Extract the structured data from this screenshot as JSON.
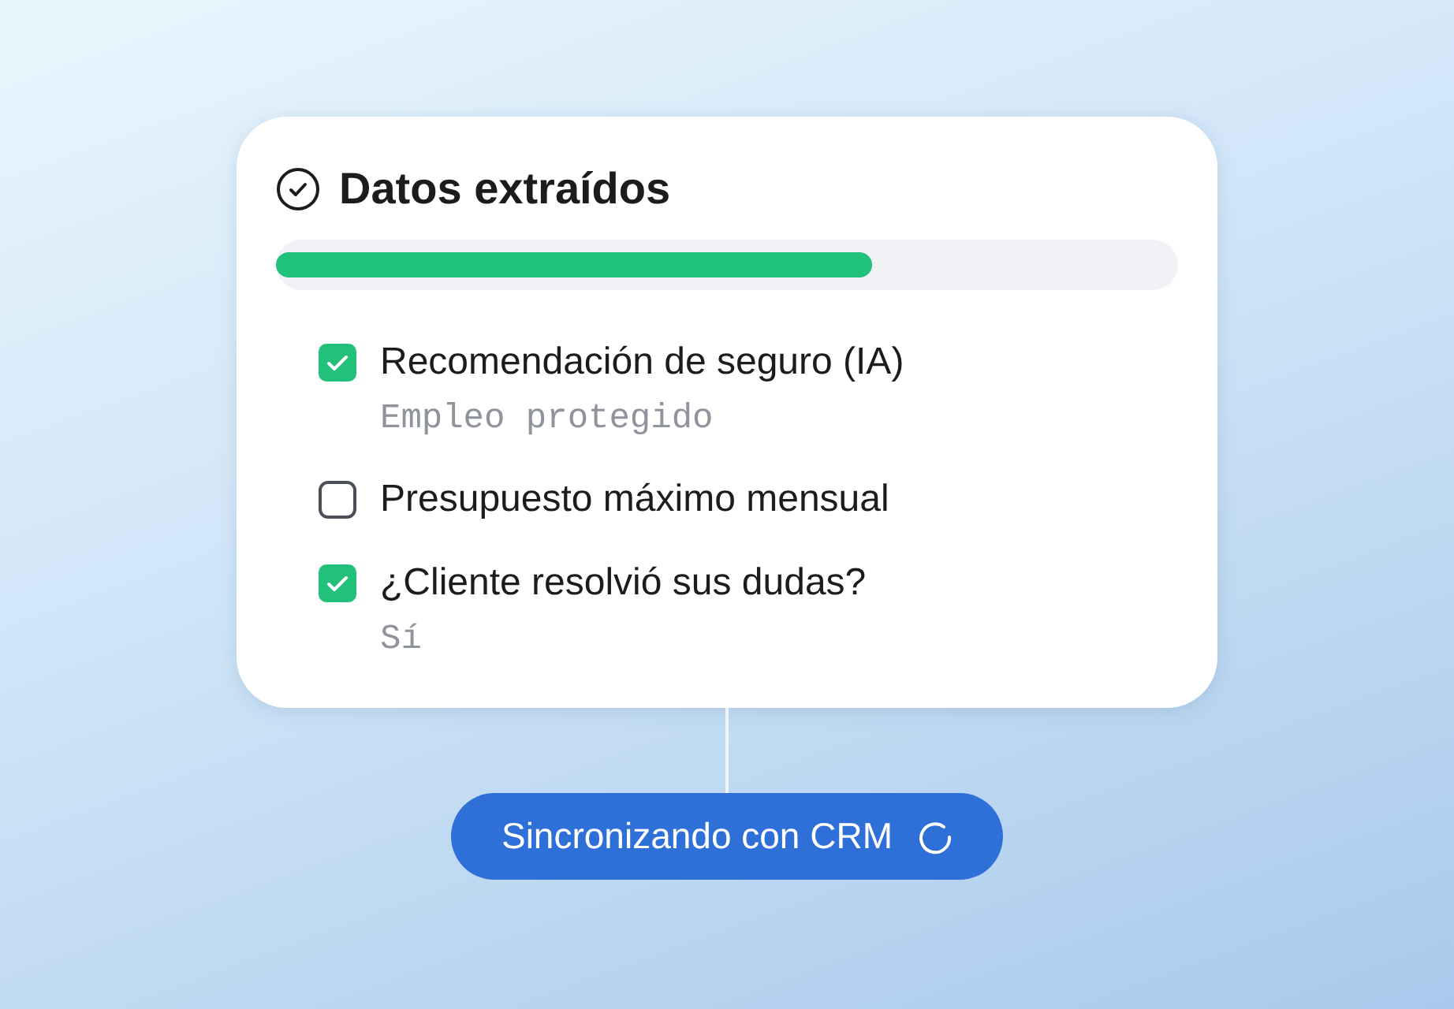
{
  "card": {
    "title": "Datos extraídos",
    "progress": {
      "level": 0.66
    },
    "fields": [
      {
        "label": "Recomendación de seguro (IA)",
        "checked": true,
        "value": "Empleo protegido"
      },
      {
        "label": "Presupuesto máximo mensual",
        "checked": false
      },
      {
        "label": "¿Cliente resolvió sus dudas?",
        "checked": true,
        "value": "Sí"
      }
    ]
  },
  "sync_button": {
    "label": "Sincronizando con CRM"
  }
}
